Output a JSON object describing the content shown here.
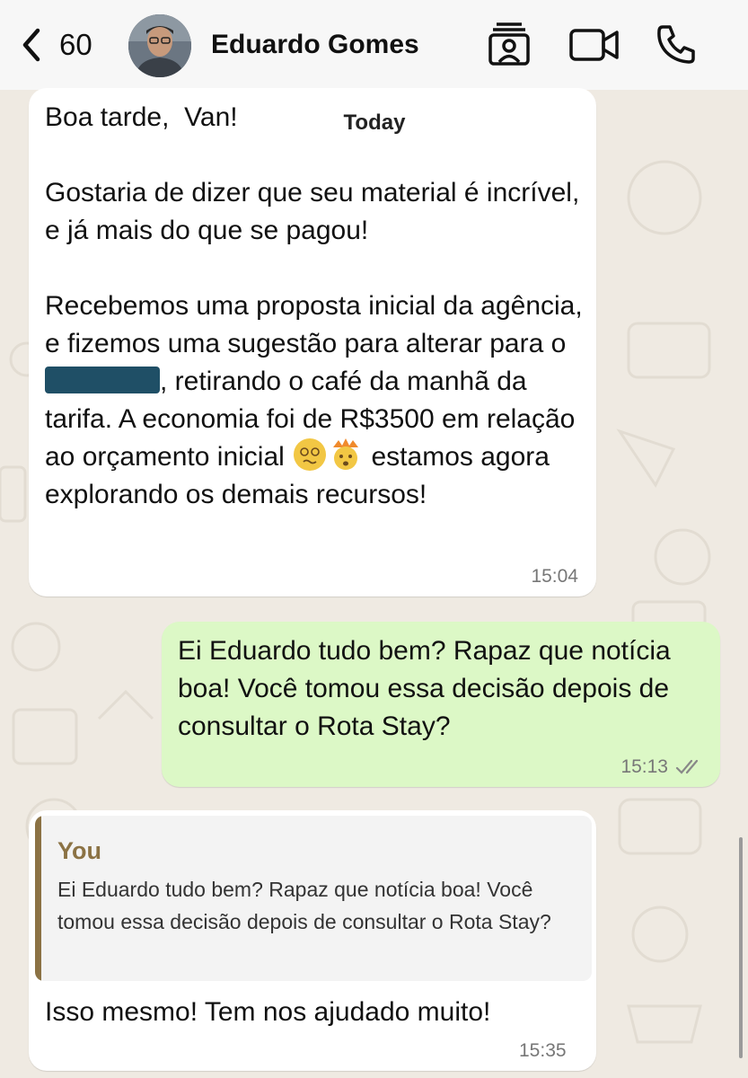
{
  "header": {
    "back_count": "60",
    "contact_name": "Eduardo Gomes",
    "icons": [
      "chevron-left-icon",
      "contact-card-icon",
      "video-call-icon",
      "phone-icon"
    ]
  },
  "date_separator": "Today",
  "messages": [
    {
      "direction": "incoming",
      "greeting": "Boa tarde,  Van!",
      "paragraph_1": "Gostaria de dizer que seu material é incrível,  e já mais do que se pagou!",
      "paragraph_2_start": "Recebemos uma proposta inicial da agência, e fizemos uma sugestão para alterar para o",
      "paragraph_2_mid": ", retirando o café da manhã da tarifa. A economia foi de R$3500 em relação ao orçamento inicial",
      "paragraph_2_end": "estamos agora explorando os demais recursos!",
      "time": "15:04"
    },
    {
      "direction": "outgoing",
      "text": "Ei Eduardo tudo bem? Rapaz que notícia boa! Você tomou essa decisão depois de consultar o Rota Stay?",
      "time": "15:13",
      "status": "read"
    },
    {
      "direction": "incoming",
      "reply_to": {
        "author": "You",
        "text": "Ei Eduardo tudo bem? Rapaz que notícia boa! Você tomou essa decisão depois de consultar o Rota Stay?"
      },
      "text": "Isso mesmo! Tem nos ajudado muito!",
      "time": "15:35"
    }
  ],
  "colors": {
    "background": "#efeae2",
    "incoming_bubble": "#ffffff",
    "outgoing_bubble": "#dcf8c6",
    "quote_accent": "#8b7244",
    "redaction": "#1f4f66"
  }
}
